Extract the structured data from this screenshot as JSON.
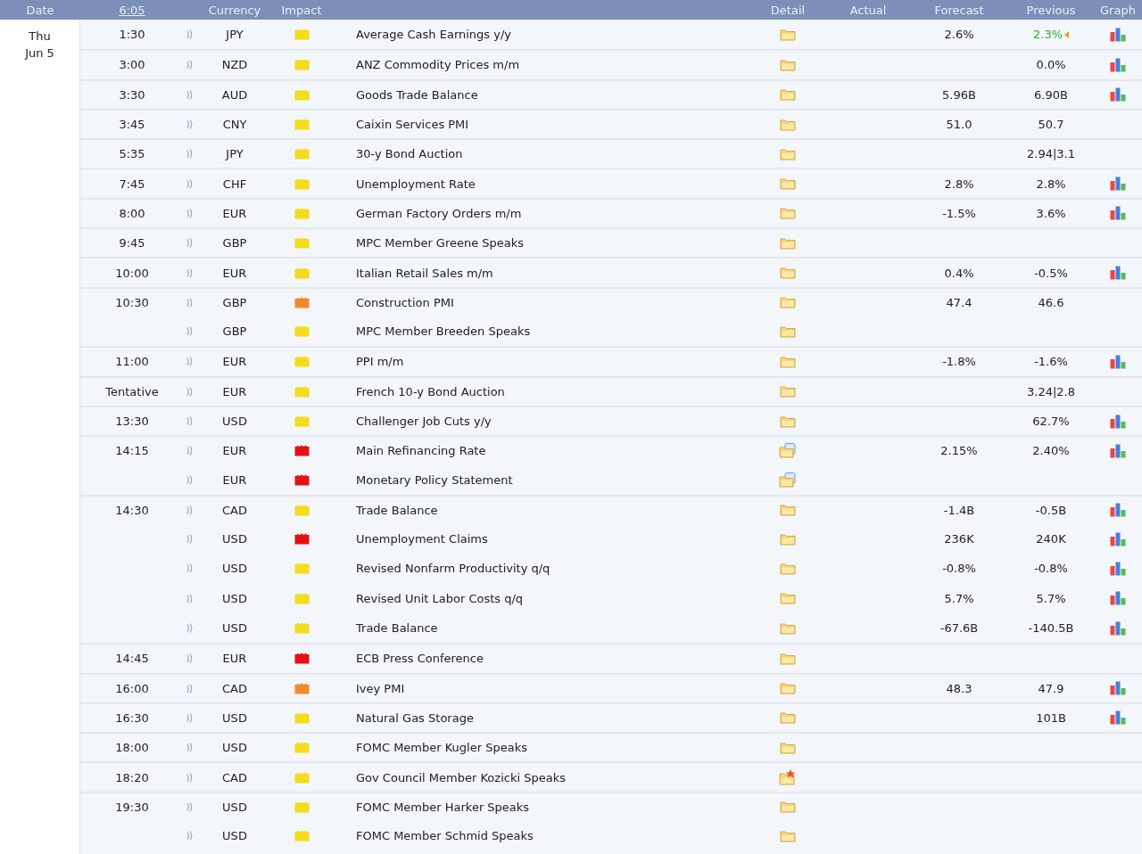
{
  "header": {
    "date": "Date",
    "time": "6:05",
    "currency": "Currency",
    "impact": "Impact",
    "detail": "Detail",
    "actual": "Actual",
    "forecast": "Forecast",
    "previous": "Previous",
    "graph": "Graph"
  },
  "day": {
    "weekday": "Thu",
    "date": "Jun 5"
  },
  "rows": [
    {
      "time": "1:30",
      "currency": "JPY",
      "color": "#f2dc1c",
      "event": "Average Cash Earnings y/y",
      "detail": {
        "kind": "folder"
      },
      "forecast": "2.6%",
      "previous": "2.3%",
      "previous_revised": true,
      "graph": true
    },
    {
      "time": "3:00",
      "currency": "NZD",
      "color": "#f2dc1c",
      "event": "ANZ Commodity Prices m/m",
      "detail": {
        "kind": "folder"
      },
      "previous": "0.0%",
      "previous_revised": false,
      "graph": true
    },
    {
      "time": "3:30",
      "currency": "AUD",
      "color": "#f2dc1c",
      "event": "Goods Trade Balance",
      "detail": {
        "kind": "folder"
      },
      "forecast": "5.96B",
      "previous": "6.90B",
      "previous_revised": false,
      "graph": true
    },
    {
      "time": "3:45",
      "currency": "CNY",
      "color": "#f2dc1c",
      "event": "Caixin Services PMI",
      "detail": {
        "kind": "folder"
      },
      "forecast": "51.0",
      "previous": "50.7",
      "previous_revised": false,
      "graph": false
    },
    {
      "time": "5:35",
      "currency": "JPY",
      "color": "#f2dc1c",
      "event": "30-y Bond Auction",
      "detail": {
        "kind": "folder"
      },
      "previous": "2.94|3.1",
      "previous_revised": false,
      "graph": false
    },
    {
      "time": "7:45",
      "currency": "CHF",
      "color": "#f2dc1c",
      "event": "Unemployment Rate",
      "detail": {
        "kind": "folder"
      },
      "forecast": "2.8%",
      "previous": "2.8%",
      "previous_revised": false,
      "graph": true
    },
    {
      "time": "8:00",
      "currency": "EUR",
      "color": "#f2dc1c",
      "event": "German Factory Orders m/m",
      "detail": {
        "kind": "folder"
      },
      "forecast": "-1.5%",
      "previous": "3.6%",
      "previous_revised": false,
      "graph": true
    },
    {
      "time": "9:45",
      "currency": "GBP",
      "color": "#f2dc1c",
      "event": "MPC Member Greene Speaks",
      "detail": {
        "kind": "folder"
      },
      "graph": false
    },
    {
      "time": "10:00",
      "currency": "EUR",
      "color": "#f2dc1c",
      "event": "Italian Retail Sales m/m",
      "detail": {
        "kind": "folder"
      },
      "forecast": "0.4%",
      "previous": "-0.5%",
      "previous_revised": false,
      "graph": true
    },
    {
      "time": "10:30",
      "currency": "GBP",
      "color": "#f08a2c",
      "event": "Construction PMI",
      "detail": {
        "kind": "folder"
      },
      "forecast": "47.4",
      "previous": "46.6",
      "previous_revised": false,
      "graph": false
    },
    {
      "currency": "GBP",
      "color": "#f2dc1c",
      "event": "MPC Member Breeden Speaks",
      "detail": {
        "kind": "folder"
      },
      "graph": false
    },
    {
      "time": "11:00",
      "currency": "EUR",
      "color": "#f2dc1c",
      "event": "PPI m/m",
      "detail": {
        "kind": "folder"
      },
      "forecast": "-1.8%",
      "previous": "-1.6%",
      "previous_revised": false,
      "graph": true
    },
    {
      "time": "Tentative",
      "currency": "EUR",
      "color": "#f2dc1c",
      "event": "French 10-y Bond Auction",
      "detail": {
        "kind": "folder"
      },
      "previous": "3.24|2.8",
      "previous_revised": false,
      "graph": false
    },
    {
      "time": "13:30",
      "currency": "USD",
      "color": "#f2dc1c",
      "event": "Challenger Job Cuts y/y",
      "detail": {
        "kind": "folder"
      },
      "previous": "62.7%",
      "previous_revised": false,
      "graph": true
    },
    {
      "time": "14:15",
      "currency": "EUR",
      "color": "#e41212",
      "event": "Main Refinancing Rate",
      "detail": {
        "kind": "document"
      },
      "forecast": "2.15%",
      "previous": "2.40%",
      "previous_revised": false,
      "graph": true
    },
    {
      "currency": "EUR",
      "color": "#e41212",
      "event": "Monetary Policy Statement",
      "detail": {
        "kind": "document"
      },
      "graph": false
    },
    {
      "time": "14:30",
      "currency": "CAD",
      "color": "#f2dc1c",
      "event": "Trade Balance",
      "detail": {
        "kind": "folder"
      },
      "forecast": "-1.4B",
      "previous": "-0.5B",
      "previous_revised": false,
      "graph": true
    },
    {
      "currency": "USD",
      "color": "#e41212",
      "event": "Unemployment Claims",
      "detail": {
        "kind": "folder"
      },
      "forecast": "236K",
      "previous": "240K",
      "previous_revised": false,
      "graph": true
    },
    {
      "currency": "USD",
      "color": "#f2dc1c",
      "event": "Revised Nonfarm Productivity q/q",
      "detail": {
        "kind": "folder"
      },
      "forecast": "-0.8%",
      "previous": "-0.8%",
      "previous_revised": false,
      "graph": true
    },
    {
      "currency": "USD",
      "color": "#f2dc1c",
      "event": "Revised Unit Labor Costs q/q",
      "detail": {
        "kind": "folder"
      },
      "forecast": "5.7%",
      "previous": "5.7%",
      "previous_revised": false,
      "graph": true
    },
    {
      "currency": "USD",
      "color": "#f2dc1c",
      "event": "Trade Balance",
      "detail": {
        "kind": "folder"
      },
      "forecast": "-67.6B",
      "previous": "-140.5B",
      "previous_revised": false,
      "graph": true
    },
    {
      "time": "14:45",
      "currency": "EUR",
      "color": "#e41212",
      "event": "ECB Press Conference",
      "detail": {
        "kind": "folder"
      },
      "graph": false
    },
    {
      "time": "16:00",
      "currency": "CAD",
      "color": "#f08a2c",
      "event": "Ivey PMI",
      "detail": {
        "kind": "folder"
      },
      "forecast": "48.3",
      "previous": "47.9",
      "previous_revised": false,
      "graph": true
    },
    {
      "time": "16:30",
      "currency": "USD",
      "color": "#f2dc1c",
      "event": "Natural Gas Storage",
      "detail": {
        "kind": "folder"
      },
      "previous": "101B",
      "previous_revised": false,
      "graph": true
    },
    {
      "time": "18:00",
      "currency": "USD",
      "color": "#f2dc1c",
      "event": "FOMC Member Kugler Speaks",
      "detail": {
        "kind": "folder"
      },
      "graph": false
    },
    {
      "time": "18:20",
      "currency": "CAD",
      "color": "#f2dc1c",
      "event": "Gov Council Member Kozicki Speaks",
      "detail": {
        "kind": "starred"
      },
      "graph": false
    },
    {
      "time": "19:30",
      "currency": "USD",
      "color": "#f2dc1c",
      "event": "FOMC Member Harker Speaks",
      "detail": {
        "kind": "folder"
      },
      "graph": false
    },
    {
      "currency": "USD",
      "color": "#f2dc1c",
      "event": "FOMC Member Schmid Speaks",
      "detail": {
        "kind": "folder"
      },
      "graph": false
    }
  ]
}
